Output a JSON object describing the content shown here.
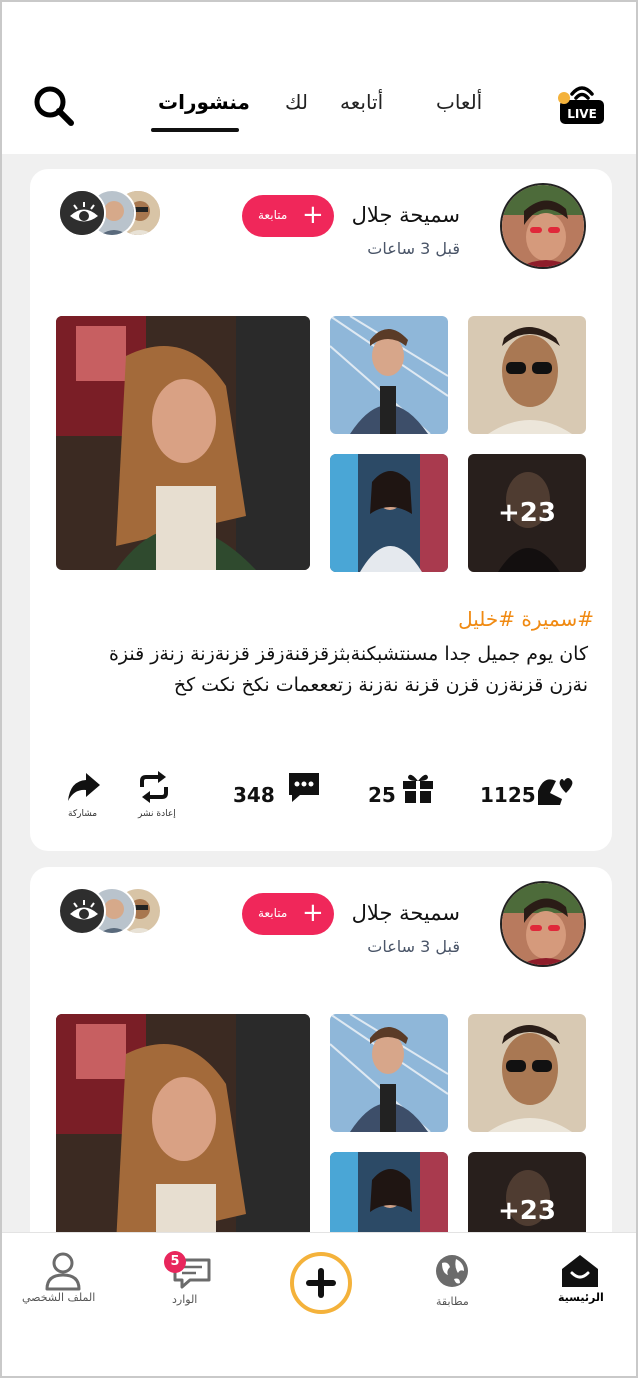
{
  "header": {
    "tabs": [
      {
        "label": "منشورات",
        "active": true
      },
      {
        "label": "لك",
        "active": false
      },
      {
        "label": "أتابعه",
        "active": false
      },
      {
        "label": "ألعاب",
        "active": false
      }
    ],
    "live_badge": "LIVE",
    "search_icon": "search-icon",
    "live_icon": "live-broadcast-icon"
  },
  "posts": [
    {
      "username": "سميحة جلال",
      "time": "قبل 3 ساعات",
      "follow_label": "متابعة",
      "more_photos": "+23",
      "hashtags": "#سميرة #خليل",
      "text": "كان يوم جميل جدا مسنتشبكنةبثزقزقنةزقز قزنةزنة زنةز قنزة نةزن قزنةزن قزن قزنة نةزنة زتعععمات نكخ نكت كخ",
      "likes": "1125",
      "gifts": "25",
      "comments": "348",
      "repost_label": "إعادة نشر",
      "share_label": "مشاركة"
    },
    {
      "username": "سميحة جلال",
      "time": "قبل 3 ساعات",
      "follow_label": "متابعة",
      "more_photos": "+23"
    }
  ],
  "bottom_nav": {
    "home": "الرئيسية",
    "match": "مطابقة",
    "inbox": "الوارد",
    "inbox_badge": "5",
    "profile": "الملف الشخصي"
  },
  "colors": {
    "accent_pink": "#f0275a",
    "hashtag_orange": "#f08a12",
    "plus_ring": "#f4b23b",
    "feed_bg": "#f0f0f0"
  }
}
